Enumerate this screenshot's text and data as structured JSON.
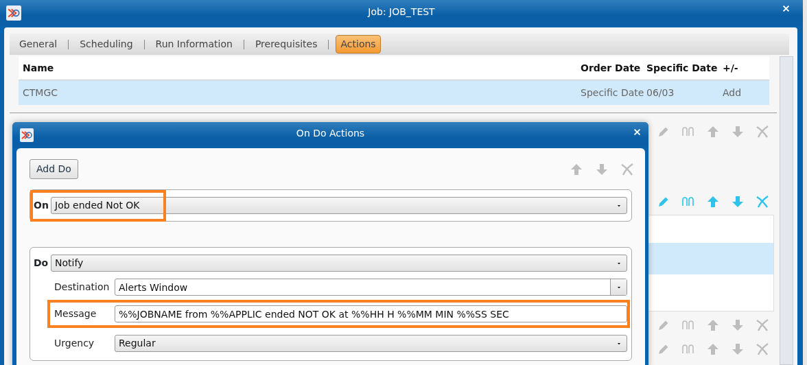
{
  "window": {
    "title": "Job: JOB_TEST"
  },
  "tabs": [
    {
      "label": "General",
      "selected": false
    },
    {
      "label": "Scheduling",
      "selected": false
    },
    {
      "label": "Run Information",
      "selected": false
    },
    {
      "label": "Prerequisites",
      "selected": false
    },
    {
      "label": "Actions",
      "selected": true
    }
  ],
  "table": {
    "columns": [
      "Name",
      "Order Date",
      "Specific Date",
      "+/-"
    ],
    "rows": [
      {
        "cells": [
          "CTMGC",
          "Specific Date",
          "06/03",
          "Add"
        ],
        "selected": true
      }
    ]
  },
  "background_toolbars": [
    {
      "enabled": false
    },
    {
      "enabled": true
    },
    {
      "enabled": false
    },
    {
      "enabled": false
    }
  ],
  "background_list": {
    "rows": [
      {
        "selected": false
      },
      {
        "selected": true
      },
      {
        "selected": false
      }
    ]
  },
  "dialog": {
    "title": "On Do Actions",
    "add_button": "Add Do",
    "toolbar_enabled": false,
    "on": {
      "label": "On",
      "value": "Job ended Not OK",
      "highlighted": true
    },
    "do": {
      "label": "Do",
      "value": "Notify",
      "fields": [
        {
          "label": "Destination",
          "value": "Alerts Window",
          "kind": "combo",
          "highlighted": false
        },
        {
          "label": "Message",
          "value": "%%JOBNAME from %%APPLIC ended NOT OK at %%HH H %%MM MIN %%SS SEC",
          "kind": "text",
          "highlighted": true
        },
        {
          "label": "Urgency",
          "value": "Regular",
          "kind": "select",
          "highlighted": false
        }
      ]
    }
  }
}
